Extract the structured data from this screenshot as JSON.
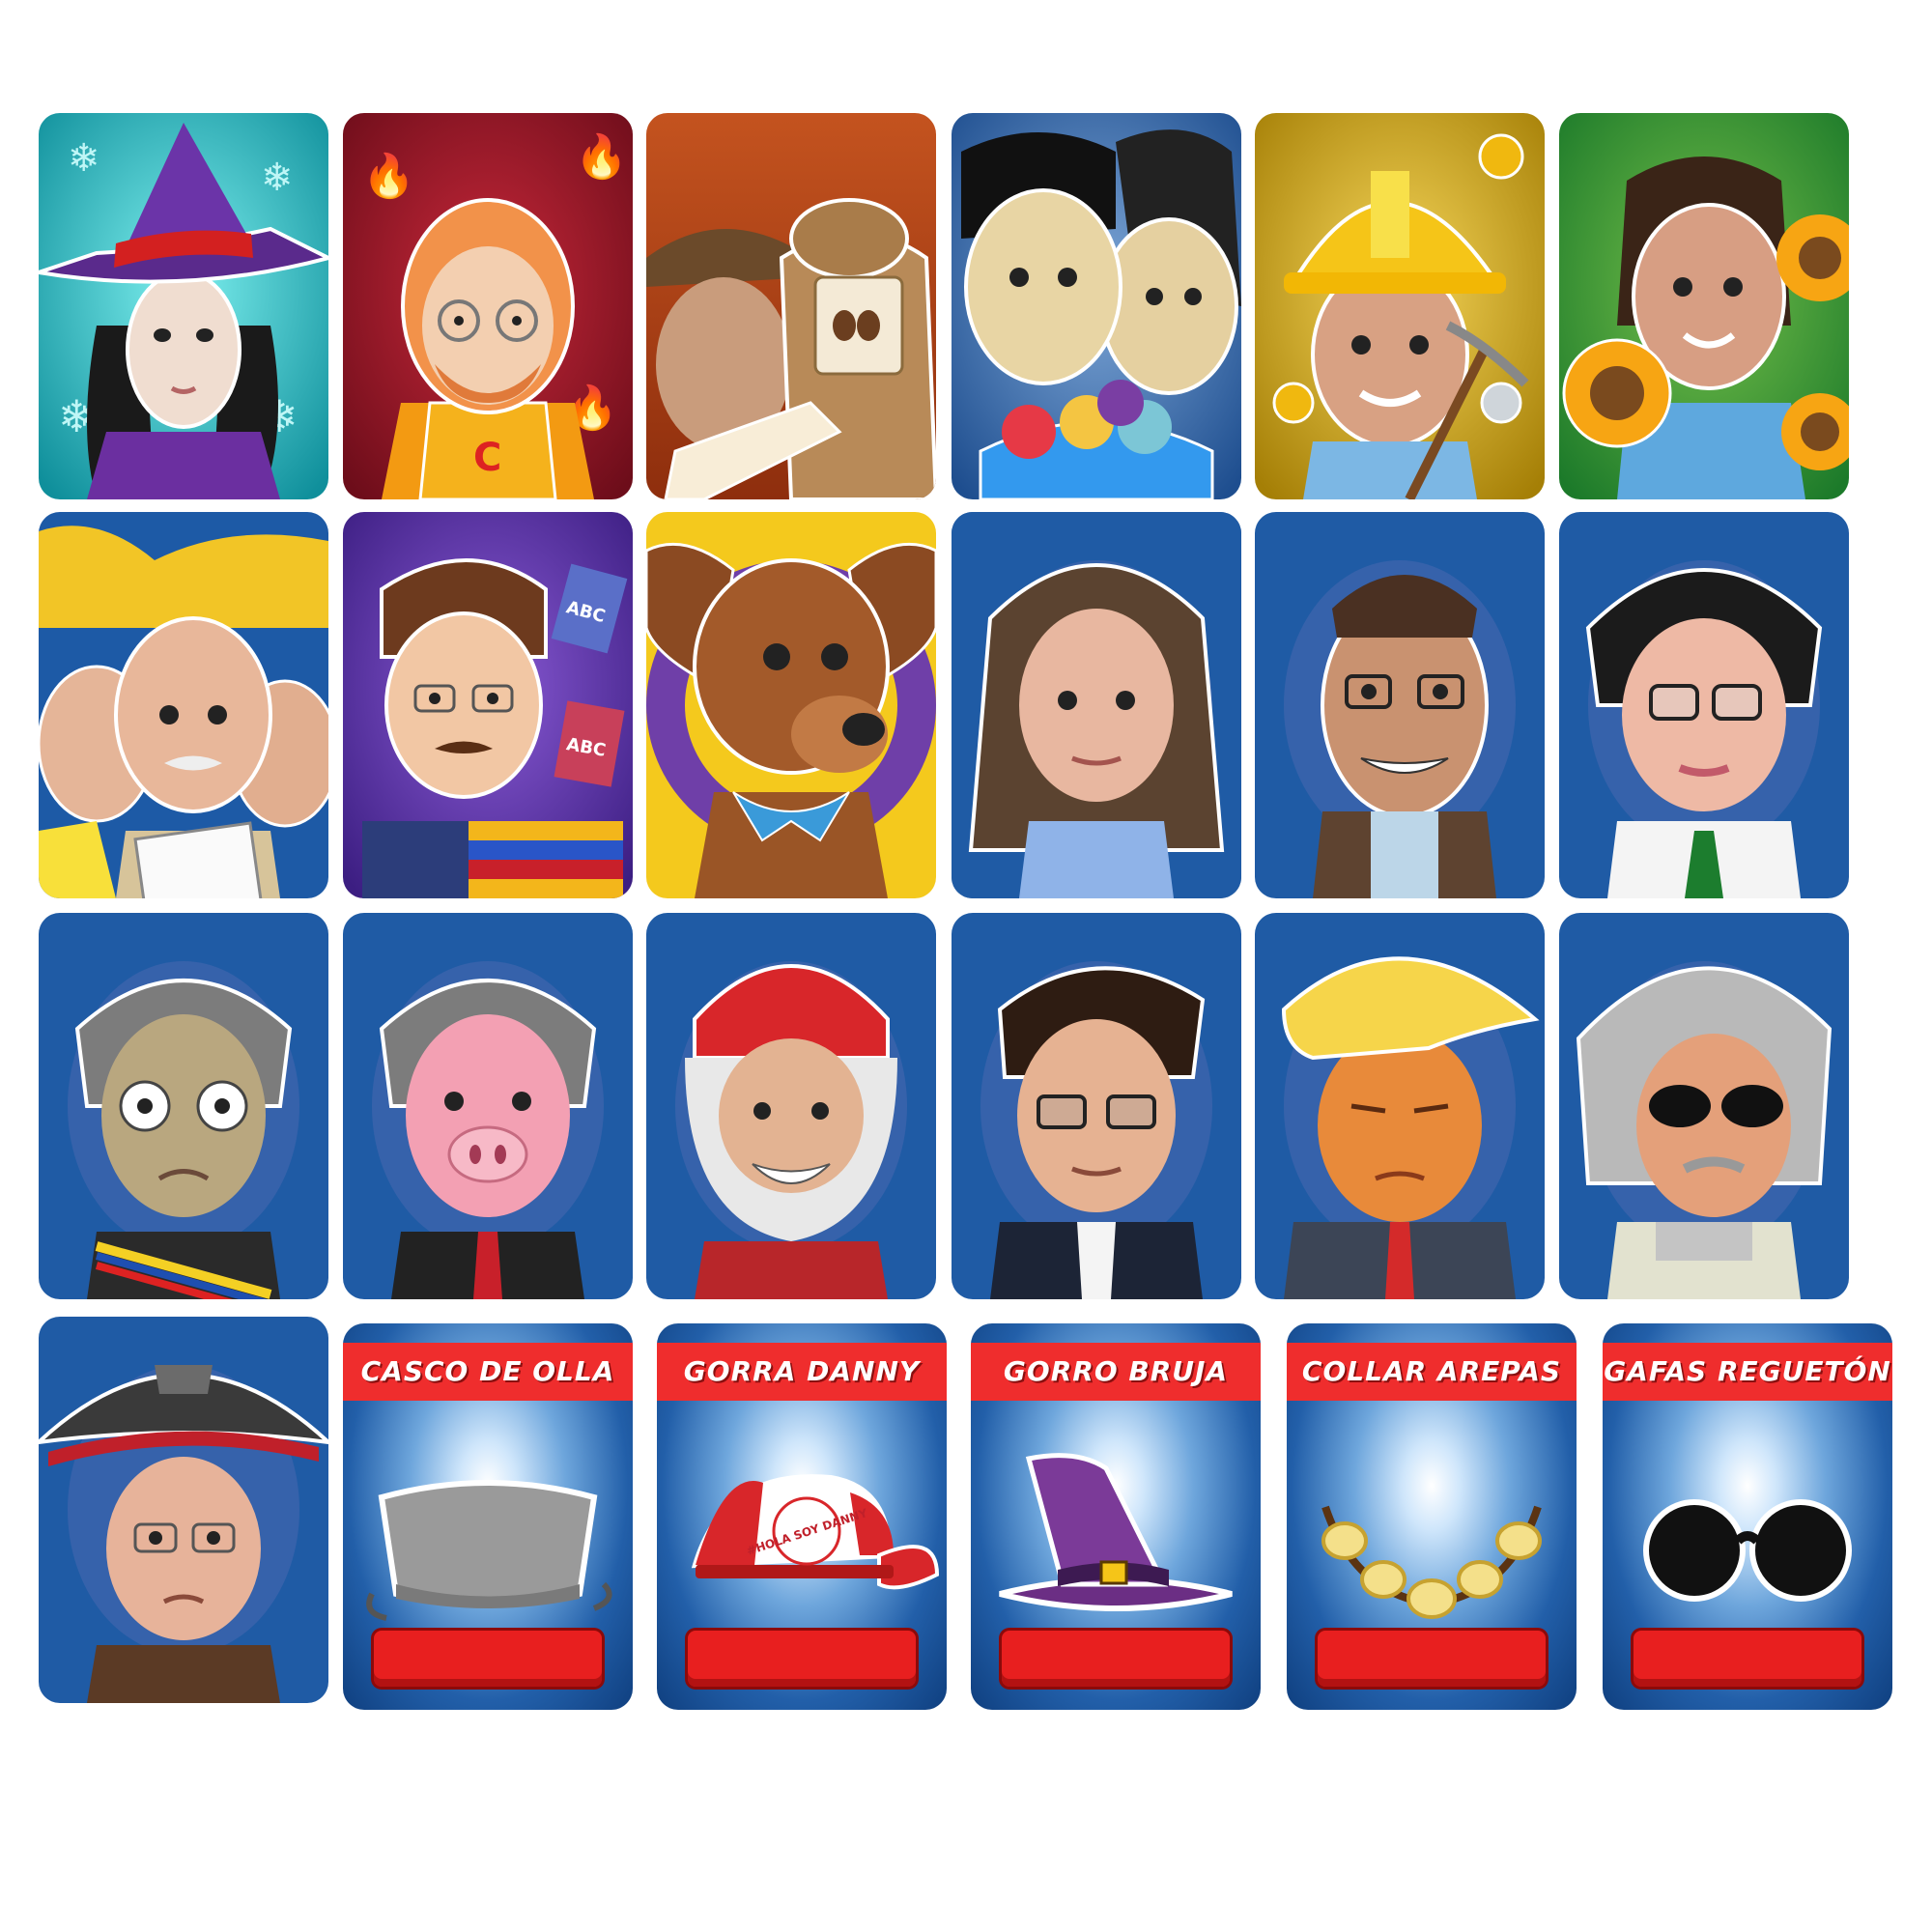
{
  "shop": {
    "items": [
      {
        "label": "CASCO DE OLLA",
        "icon": "pot-helmet-icon"
      },
      {
        "label": "GORRA DANNY",
        "icon": "danny-cap-icon",
        "cap_text": "#HOLA SOY DANNY"
      },
      {
        "label": "GORRO BRUJA",
        "icon": "witch-hat-icon"
      },
      {
        "label": "COLLAR AREPAS",
        "icon": "arepa-necklace-icon"
      },
      {
        "label": "GAFAS REGUETÓN",
        "icon": "reggaeton-glasses-icon"
      }
    ],
    "book_labels": [
      "ABC",
      "ABC"
    ]
  },
  "colors": {
    "item_header": "#ef2d2d",
    "price_bar": "#e81f1f",
    "card_blue": "#225fa9"
  }
}
